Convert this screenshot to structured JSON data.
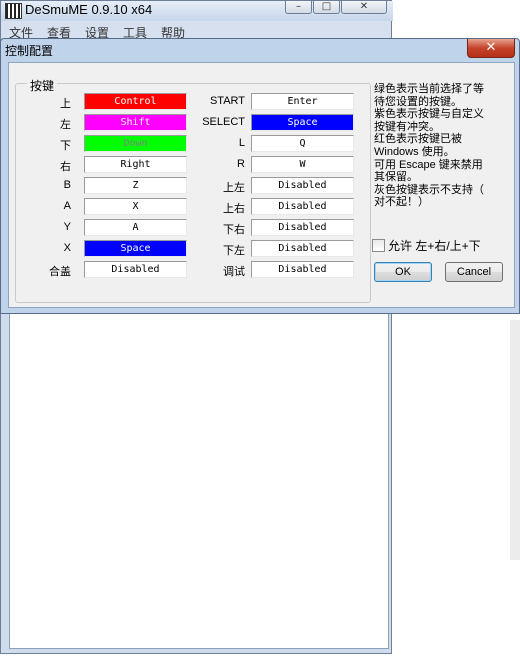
{
  "background_window": {
    "title": "DeSmuME 0.9.10 x64",
    "menu": [
      "文件",
      "查看",
      "设置",
      "工具",
      "帮助"
    ]
  },
  "dialog": {
    "title": "控制配置",
    "group_label": "按键",
    "left_keys": [
      {
        "label": "上",
        "value": "Control",
        "status": "red"
      },
      {
        "label": "左",
        "value": "Shift",
        "status": "magenta"
      },
      {
        "label": "下",
        "value": "Down",
        "status": "green"
      },
      {
        "label": "右",
        "value": "Right",
        "status": "none"
      },
      {
        "label": "B",
        "value": "Z",
        "status": "none"
      },
      {
        "label": "A",
        "value": "X",
        "status": "none"
      },
      {
        "label": "Y",
        "value": "A",
        "status": "none"
      },
      {
        "label": "X",
        "value": "Space",
        "status": "blue"
      },
      {
        "label": "合盖",
        "value": "Disabled",
        "status": "none"
      }
    ],
    "right_keys": [
      {
        "label": "START",
        "value": "Enter",
        "status": "none"
      },
      {
        "label": "SELECT",
        "value": "Space",
        "status": "blue"
      },
      {
        "label": "L",
        "value": "Q",
        "status": "none"
      },
      {
        "label": "R",
        "value": "W",
        "status": "none"
      },
      {
        "label": "上左",
        "value": "Disabled",
        "status": "none"
      },
      {
        "label": "上右",
        "value": "Disabled",
        "status": "none"
      },
      {
        "label": "下右",
        "value": "Disabled",
        "status": "none"
      },
      {
        "label": "下左",
        "value": "Disabled",
        "status": "none"
      },
      {
        "label": "调试",
        "value": "Disabled",
        "status": "none"
      }
    ],
    "info_lines": [
      "绿色表示当前选择了等",
      "待您设置的按键。",
      "紫色表示按键与自定义",
      "按键有冲突。",
      "红色表示按键已被",
      "Windows 使用。",
      "可用 Escape 键来禁用",
      "其保留。",
      "灰色按键表示不支持（",
      "对不起！）"
    ],
    "checkbox_label": "允许 左+右/上+下",
    "checkbox_checked": false,
    "ok_label": "OK",
    "cancel_label": "Cancel",
    "close_glyph": "✕"
  },
  "colors": {
    "red": "#ff0000",
    "magenta": "#ff00ff",
    "green": "#00ff00",
    "blue": "#0000ff",
    "none": "#ffffff"
  }
}
